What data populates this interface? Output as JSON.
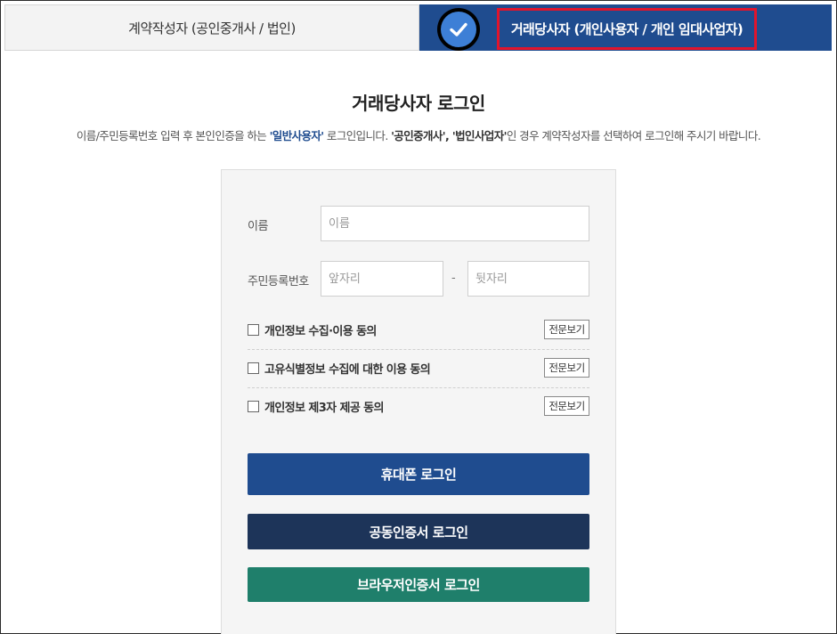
{
  "tabs": {
    "left_label": "계약작성자 (공인중개사 / 법인)",
    "right_label": "거래당사자 (개인사용자 / 개인 임대사업자)"
  },
  "title": "거래당사자 로그인",
  "description": {
    "part1": "이름/주민등록번호 입력 후 본인인증을 하는 ",
    "hl1": "'일반사용자'",
    "part2": " 로그인입니다. ",
    "hl2": "'공인중개사', '법인사업자'",
    "part3": "인 경우 계약작성자를 선택하여 로그인해 주시기 바랍니다."
  },
  "form": {
    "name_label": "이름",
    "name_placeholder": "이름",
    "rrn_label": "주민등록번호",
    "rrn_front_placeholder": "앞자리",
    "rrn_separator": "-",
    "rrn_back_placeholder": "뒷자리"
  },
  "agreements": [
    {
      "label": "개인정보 수집·이용 동의",
      "view": "전문보기"
    },
    {
      "label": "고유식별정보 수집에 대한 이용 동의",
      "view": "전문보기"
    },
    {
      "label": "개인정보 제3자 제공 동의",
      "view": "전문보기"
    }
  ],
  "buttons": {
    "phone": "휴대폰 로그인",
    "cert": "공동인증서 로그인",
    "browser": "브라우저인증서 로그인"
  },
  "colors": {
    "active_tab": "#1f4c8f",
    "highlight_border": "#e1142c",
    "phone_button": "#1f4c8f",
    "cert_button": "#1d3459",
    "browser_button": "#1f7f6b"
  }
}
